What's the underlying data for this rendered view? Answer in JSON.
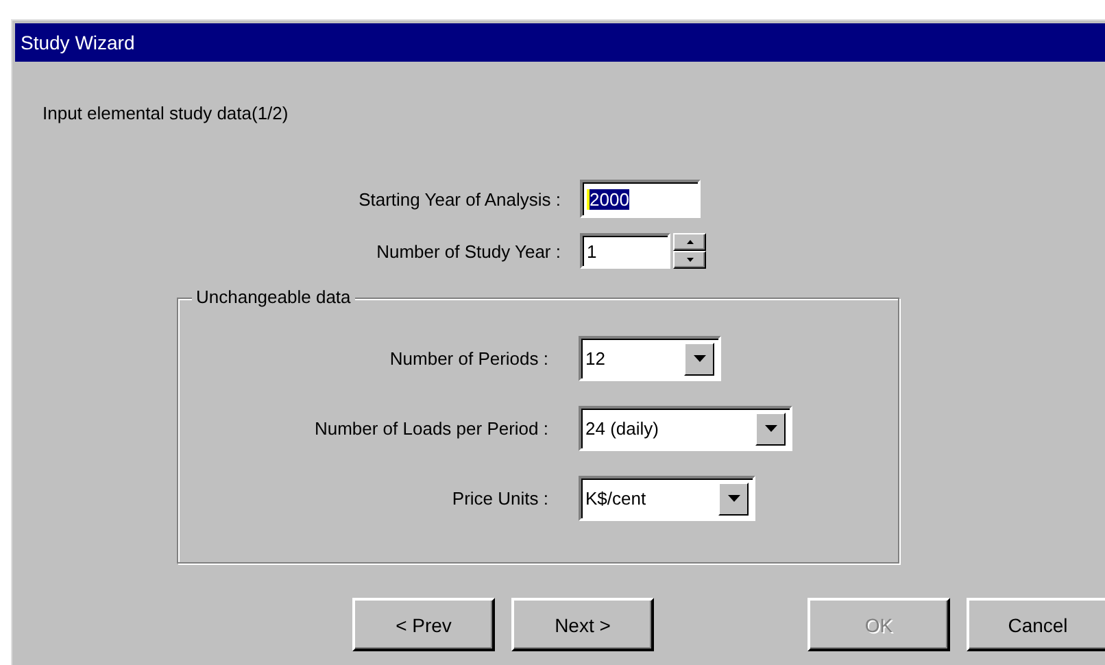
{
  "window": {
    "title": "Study Wizard"
  },
  "heading": "Input elemental study data(1/2)",
  "fields": [
    {
      "kind": "text",
      "label": "Starting Year of Analysis :",
      "value": "2000",
      "selected": true
    },
    {
      "kind": "spinner",
      "label": "Number of Study Year :",
      "value": "1",
      "selected": false
    }
  ],
  "group": {
    "title": "Unchangeable data",
    "fields": [
      {
        "kind": "combo",
        "label": "Number of Periods :",
        "value": "12"
      },
      {
        "kind": "combo",
        "label": "Number of Loads per Period :",
        "value": "24 (daily)"
      },
      {
        "kind": "combo",
        "label": "Price Units :",
        "value": "K$/cent"
      }
    ]
  },
  "buttons": [
    {
      "label": "< Prev",
      "disabled": false
    },
    {
      "label": "Next >",
      "disabled": false
    },
    {
      "label": "OK",
      "disabled": true
    },
    {
      "label": "Cancel",
      "disabled": false
    }
  ]
}
